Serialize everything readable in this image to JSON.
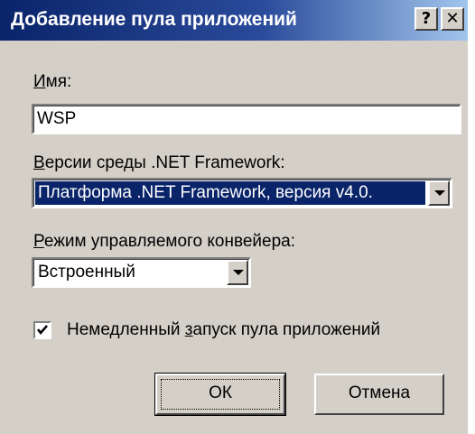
{
  "window": {
    "title": "Добавление пула приложений",
    "help_glyph": "?",
    "close_glyph": "✕"
  },
  "form": {
    "name_label_hotkey": "И",
    "name_label_rest": "мя:",
    "name_value": "WSP",
    "framework_label_hotkey": "В",
    "framework_label_rest": "ерсии среды .NET Framework:",
    "framework_value": "Платформа .NET Framework, версия v4.0.",
    "pipeline_label_hotkey": "Р",
    "pipeline_label_rest": "ежим управляемого конвейера:",
    "pipeline_value": "Встроенный",
    "start_label_before": "Немедленный ",
    "start_label_hotkey": "з",
    "start_label_after": "апуск пула приложений",
    "start_checked": true
  },
  "buttons": {
    "ok_label": "ОК",
    "cancel_label": "Отмена"
  },
  "colors": {
    "titlebar_start": "#0a246a",
    "titlebar_end": "#a6caf0",
    "dialog_bg": "#d4d0c8",
    "selection_bg": "#0a246a"
  },
  "icons": {
    "help": "help-icon",
    "close": "close-icon",
    "dropdown": "chevron-down-icon",
    "check": "checkmark-icon"
  }
}
